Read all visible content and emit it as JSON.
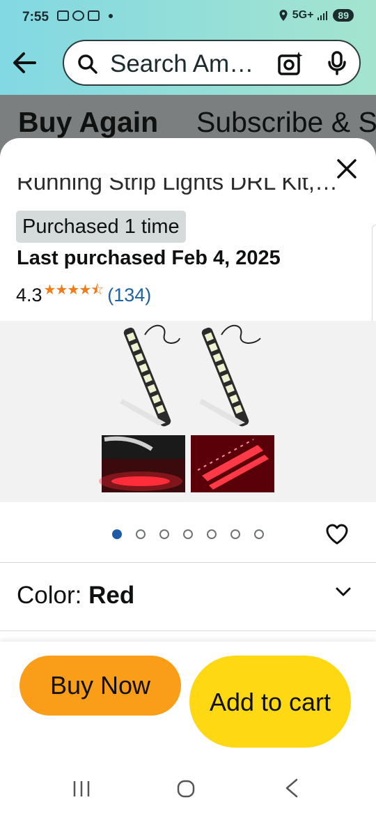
{
  "status_bar": {
    "time": "7:55",
    "network": "5G+",
    "battery": "89"
  },
  "search": {
    "placeholder": "Search Am…"
  },
  "tabs": [
    {
      "label": "Buy Again"
    },
    {
      "label": "Subscribe & S"
    }
  ],
  "sheet": {
    "title_fragment": "Running Strip Lights DRL Kit,…",
    "purchased_badge": "Purchased 1 time",
    "last_purchased": "Last purchased Feb 4, 2025",
    "rating": {
      "value": "4.3",
      "stars": 4.3,
      "count": "(134)"
    },
    "image_carousel": {
      "total": 7,
      "active_index": 0
    },
    "color": {
      "label": "Color: ",
      "value": "Red"
    }
  },
  "actions": {
    "buy_now": "Buy Now",
    "add_to_cart": "Add to cart"
  },
  "icons": [
    "back-arrow-icon",
    "search-icon",
    "camera-lens-icon",
    "microphone-icon",
    "close-icon",
    "heart-icon",
    "chevron-down-icon",
    "recents-icon",
    "home-icon",
    "back-icon"
  ],
  "colors": {
    "buy_now": "#fa9d19",
    "add_to_cart": "#ffd814",
    "active_dot": "#1f5aa6",
    "rating_stars": "#ee7c19",
    "link_blue": "#2162a1"
  }
}
